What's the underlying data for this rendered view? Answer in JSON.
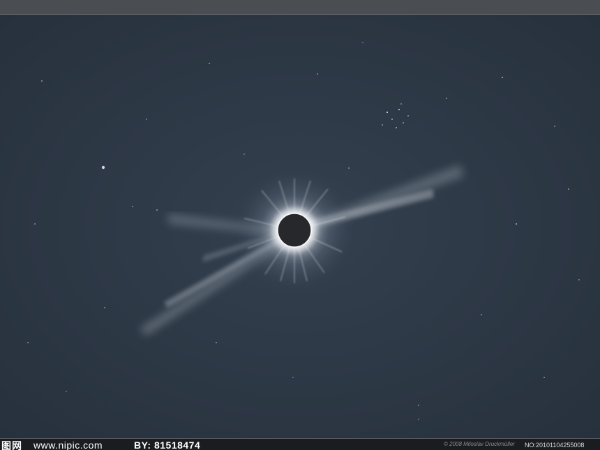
{
  "watermark": {
    "logo_text": "图网",
    "site_url": "www.nipic.com",
    "by_label": "BY: 81518474",
    "copyright": "© 2008 Miloslav Druckmüller",
    "image_no": "NO:20101104255008"
  },
  "colors": {
    "sky": "#2a3340",
    "corona": "#e8ecf2",
    "moon": "#26282b"
  }
}
